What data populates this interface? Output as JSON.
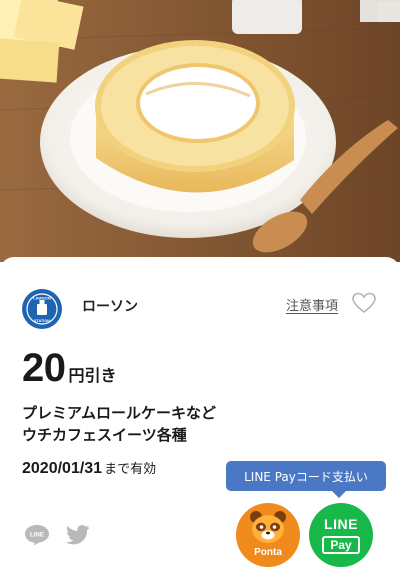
{
  "store": {
    "name": "ローソン",
    "logo_text_top": "LAWSON",
    "logo_text_bottom": "STATION"
  },
  "header": {
    "notes_link": "注意事項",
    "favorite_icon": "heart-outline-icon"
  },
  "coupon": {
    "discount_amount": "20",
    "discount_unit": "円引き",
    "product_line1": "プレミアムロールケーキなど",
    "product_line2": "ウチカフェスイーツ各種",
    "expiry_date": "2020/01/31",
    "expiry_suffix": "まで有効"
  },
  "payment": {
    "tooltip": "LINE Payコード支払い",
    "ponta_label": "Ponta",
    "linepay_line1": "LINE",
    "linepay_line2": "Pay"
  },
  "share": {
    "line_icon": "line-share-icon",
    "twitter_icon": "twitter-share-icon"
  },
  "colors": {
    "tooltip_bg": "#4a78c4",
    "ponta_orange": "#f08a1c",
    "linepay_green": "#18b84a",
    "lawson_blue": "#1f63b3"
  }
}
